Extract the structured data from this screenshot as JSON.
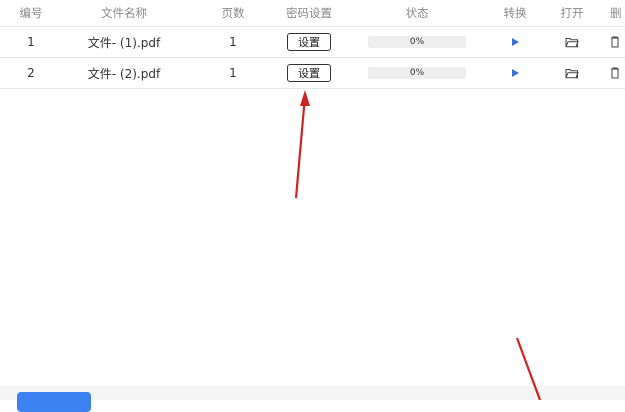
{
  "table": {
    "headers": [
      "编号",
      "文件名称",
      "页数",
      "密码设置",
      "状态",
      "转换",
      "打开",
      "删"
    ],
    "rows": [
      {
        "no": "1",
        "name": "文件- (1).pdf",
        "pages": "1",
        "set_label": "设置",
        "status": "0%"
      },
      {
        "no": "2",
        "name": "文件- (2).pdf",
        "pages": "1",
        "set_label": "设置",
        "status": "0%"
      }
    ]
  },
  "icons": {
    "convert": "play-icon",
    "open": "folder-icon",
    "delete": "trash-icon"
  },
  "colors": {
    "accent": "#3b72d9",
    "button_primary": "#3b82f0",
    "annotation_arrow": "#d32222"
  }
}
